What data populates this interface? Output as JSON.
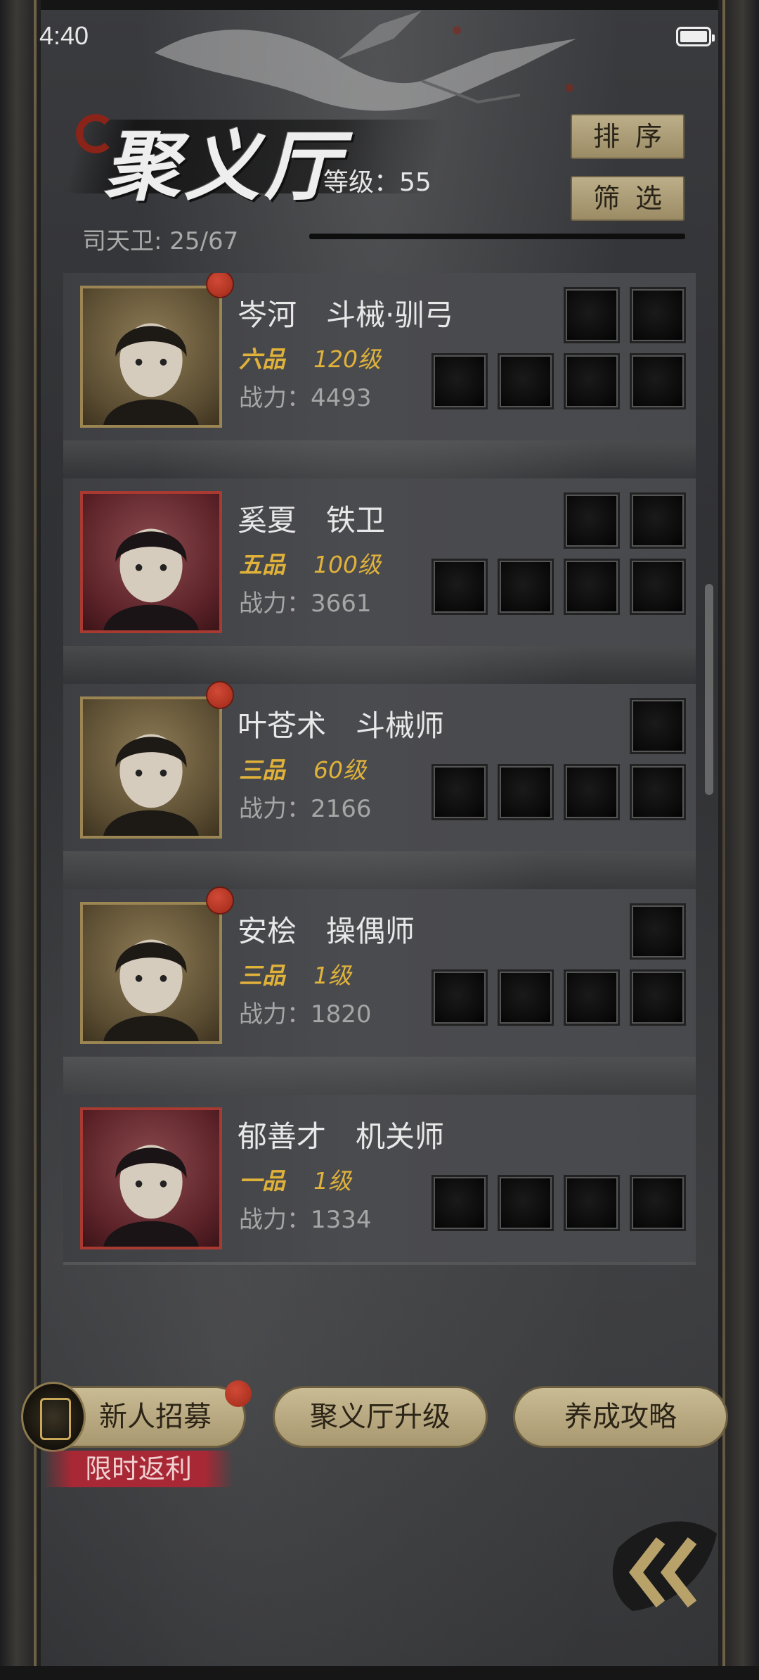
{
  "status": {
    "time": "4:40"
  },
  "header": {
    "title": "聚义厅",
    "level": "等级：55",
    "guards": "司天卫: 25/67",
    "sort_label": "排序",
    "filter_label": "筛选"
  },
  "heroes": [
    {
      "name": "岑河　斗械·驯弓",
      "rank": "六品",
      "level": "120级",
      "power": "战力：4493",
      "frame": "gold",
      "badge": true,
      "top_slots": 2
    },
    {
      "name": "奚夏　铁卫",
      "rank": "五品",
      "level": "100级",
      "power": "战力：3661",
      "frame": "red",
      "badge": false,
      "top_slots": 2
    },
    {
      "name": "叶苍术　斗械师",
      "rank": "三品",
      "level": "60级",
      "power": "战力：2166",
      "frame": "gold",
      "badge": true,
      "top_slots": 1
    },
    {
      "name": "安桧　操偶师",
      "rank": "三品",
      "level": "1级",
      "power": "战力：1820",
      "frame": "gold",
      "badge": true,
      "top_slots": 1
    },
    {
      "name": "郁善才　机关师",
      "rank": "一品",
      "level": "1级",
      "power": "战力：1334",
      "frame": "red",
      "badge": false,
      "top_slots": 0
    }
  ],
  "bottom": {
    "recruit_label": "新人招募",
    "upgrade_label": "聚义厅升级",
    "guide_label": "养成攻略",
    "limited_label": "限时返利"
  },
  "colors": {
    "gold_text": "#e0b23a",
    "button_tan": "#bcae88",
    "badge_red": "#c0392b"
  },
  "icons": {
    "back": "double-chevron-left-icon",
    "recruit": "recruit-token-icon"
  }
}
